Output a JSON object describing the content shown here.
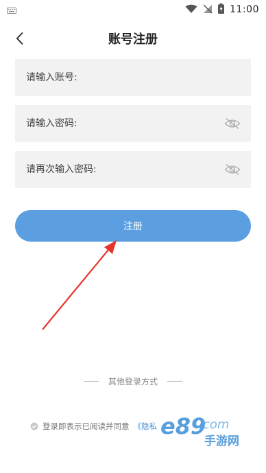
{
  "status_bar": {
    "time": "11:00"
  },
  "header": {
    "title": "账号注册"
  },
  "form": {
    "account_placeholder": "请输入账号:",
    "password_placeholder": "请输入密码:",
    "confirm_placeholder": "请再次输入密码:"
  },
  "register_button": {
    "label": "注册"
  },
  "other_login": {
    "label": "其他登录方式"
  },
  "agreement": {
    "text": "登录即表示已阅读并同意",
    "link": "《隐私"
  },
  "watermark": {
    "brand": "e89",
    "suffix": "com",
    "subtitle": "手游网"
  },
  "colors": {
    "accent": "#5b9fe0",
    "arrow": "#e8352b"
  }
}
